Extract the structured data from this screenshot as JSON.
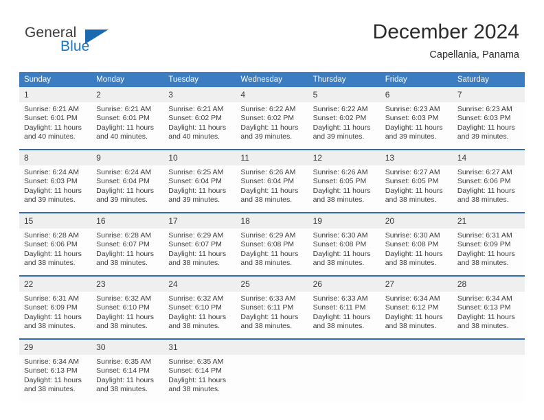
{
  "brand": {
    "name_top": "General",
    "name_bottom": "Blue",
    "triangle_color": "#1b6ab0",
    "blue_color": "#1b76c3"
  },
  "header": {
    "title": "December 2024",
    "location": "Capellania, Panama"
  },
  "theme": {
    "header_blue": "#3b7dc0",
    "separator_blue": "#2d6aad",
    "daynum_band": "#efefef",
    "text": "#3a3a3a"
  },
  "calendar": {
    "weekday_headers": [
      "Sunday",
      "Monday",
      "Tuesday",
      "Wednesday",
      "Thursday",
      "Friday",
      "Saturday"
    ],
    "labels": {
      "sunrise_prefix": "Sunrise: ",
      "sunset_prefix": "Sunset: ",
      "daylight_prefix": "Daylight: "
    },
    "weeks": [
      [
        {
          "day": "1",
          "sunrise": "Sunrise: 6:21 AM",
          "sunset": "Sunset: 6:01 PM",
          "daylight": "Daylight: 11 hours and 40 minutes."
        },
        {
          "day": "2",
          "sunrise": "Sunrise: 6:21 AM",
          "sunset": "Sunset: 6:01 PM",
          "daylight": "Daylight: 11 hours and 40 minutes."
        },
        {
          "day": "3",
          "sunrise": "Sunrise: 6:21 AM",
          "sunset": "Sunset: 6:02 PM",
          "daylight": "Daylight: 11 hours and 40 minutes."
        },
        {
          "day": "4",
          "sunrise": "Sunrise: 6:22 AM",
          "sunset": "Sunset: 6:02 PM",
          "daylight": "Daylight: 11 hours and 39 minutes."
        },
        {
          "day": "5",
          "sunrise": "Sunrise: 6:22 AM",
          "sunset": "Sunset: 6:02 PM",
          "daylight": "Daylight: 11 hours and 39 minutes."
        },
        {
          "day": "6",
          "sunrise": "Sunrise: 6:23 AM",
          "sunset": "Sunset: 6:03 PM",
          "daylight": "Daylight: 11 hours and 39 minutes."
        },
        {
          "day": "7",
          "sunrise": "Sunrise: 6:23 AM",
          "sunset": "Sunset: 6:03 PM",
          "daylight": "Daylight: 11 hours and 39 minutes."
        }
      ],
      [
        {
          "day": "8",
          "sunrise": "Sunrise: 6:24 AM",
          "sunset": "Sunset: 6:03 PM",
          "daylight": "Daylight: 11 hours and 39 minutes."
        },
        {
          "day": "9",
          "sunrise": "Sunrise: 6:24 AM",
          "sunset": "Sunset: 6:04 PM",
          "daylight": "Daylight: 11 hours and 39 minutes."
        },
        {
          "day": "10",
          "sunrise": "Sunrise: 6:25 AM",
          "sunset": "Sunset: 6:04 PM",
          "daylight": "Daylight: 11 hours and 39 minutes."
        },
        {
          "day": "11",
          "sunrise": "Sunrise: 6:26 AM",
          "sunset": "Sunset: 6:04 PM",
          "daylight": "Daylight: 11 hours and 38 minutes."
        },
        {
          "day": "12",
          "sunrise": "Sunrise: 6:26 AM",
          "sunset": "Sunset: 6:05 PM",
          "daylight": "Daylight: 11 hours and 38 minutes."
        },
        {
          "day": "13",
          "sunrise": "Sunrise: 6:27 AM",
          "sunset": "Sunset: 6:05 PM",
          "daylight": "Daylight: 11 hours and 38 minutes."
        },
        {
          "day": "14",
          "sunrise": "Sunrise: 6:27 AM",
          "sunset": "Sunset: 6:06 PM",
          "daylight": "Daylight: 11 hours and 38 minutes."
        }
      ],
      [
        {
          "day": "15",
          "sunrise": "Sunrise: 6:28 AM",
          "sunset": "Sunset: 6:06 PM",
          "daylight": "Daylight: 11 hours and 38 minutes."
        },
        {
          "day": "16",
          "sunrise": "Sunrise: 6:28 AM",
          "sunset": "Sunset: 6:07 PM",
          "daylight": "Daylight: 11 hours and 38 minutes."
        },
        {
          "day": "17",
          "sunrise": "Sunrise: 6:29 AM",
          "sunset": "Sunset: 6:07 PM",
          "daylight": "Daylight: 11 hours and 38 minutes."
        },
        {
          "day": "18",
          "sunrise": "Sunrise: 6:29 AM",
          "sunset": "Sunset: 6:08 PM",
          "daylight": "Daylight: 11 hours and 38 minutes."
        },
        {
          "day": "19",
          "sunrise": "Sunrise: 6:30 AM",
          "sunset": "Sunset: 6:08 PM",
          "daylight": "Daylight: 11 hours and 38 minutes."
        },
        {
          "day": "20",
          "sunrise": "Sunrise: 6:30 AM",
          "sunset": "Sunset: 6:08 PM",
          "daylight": "Daylight: 11 hours and 38 minutes."
        },
        {
          "day": "21",
          "sunrise": "Sunrise: 6:31 AM",
          "sunset": "Sunset: 6:09 PM",
          "daylight": "Daylight: 11 hours and 38 minutes."
        }
      ],
      [
        {
          "day": "22",
          "sunrise": "Sunrise: 6:31 AM",
          "sunset": "Sunset: 6:09 PM",
          "daylight": "Daylight: 11 hours and 38 minutes."
        },
        {
          "day": "23",
          "sunrise": "Sunrise: 6:32 AM",
          "sunset": "Sunset: 6:10 PM",
          "daylight": "Daylight: 11 hours and 38 minutes."
        },
        {
          "day": "24",
          "sunrise": "Sunrise: 6:32 AM",
          "sunset": "Sunset: 6:10 PM",
          "daylight": "Daylight: 11 hours and 38 minutes."
        },
        {
          "day": "25",
          "sunrise": "Sunrise: 6:33 AM",
          "sunset": "Sunset: 6:11 PM",
          "daylight": "Daylight: 11 hours and 38 minutes."
        },
        {
          "day": "26",
          "sunrise": "Sunrise: 6:33 AM",
          "sunset": "Sunset: 6:11 PM",
          "daylight": "Daylight: 11 hours and 38 minutes."
        },
        {
          "day": "27",
          "sunrise": "Sunrise: 6:34 AM",
          "sunset": "Sunset: 6:12 PM",
          "daylight": "Daylight: 11 hours and 38 minutes."
        },
        {
          "day": "28",
          "sunrise": "Sunrise: 6:34 AM",
          "sunset": "Sunset: 6:13 PM",
          "daylight": "Daylight: 11 hours and 38 minutes."
        }
      ],
      [
        {
          "day": "29",
          "sunrise": "Sunrise: 6:34 AM",
          "sunset": "Sunset: 6:13 PM",
          "daylight": "Daylight: 11 hours and 38 minutes."
        },
        {
          "day": "30",
          "sunrise": "Sunrise: 6:35 AM",
          "sunset": "Sunset: 6:14 PM",
          "daylight": "Daylight: 11 hours and 38 minutes."
        },
        {
          "day": "31",
          "sunrise": "Sunrise: 6:35 AM",
          "sunset": "Sunset: 6:14 PM",
          "daylight": "Daylight: 11 hours and 38 minutes."
        },
        {
          "day": "",
          "sunrise": "",
          "sunset": "",
          "daylight": ""
        },
        {
          "day": "",
          "sunrise": "",
          "sunset": "",
          "daylight": ""
        },
        {
          "day": "",
          "sunrise": "",
          "sunset": "",
          "daylight": ""
        },
        {
          "day": "",
          "sunrise": "",
          "sunset": "",
          "daylight": ""
        }
      ]
    ]
  }
}
